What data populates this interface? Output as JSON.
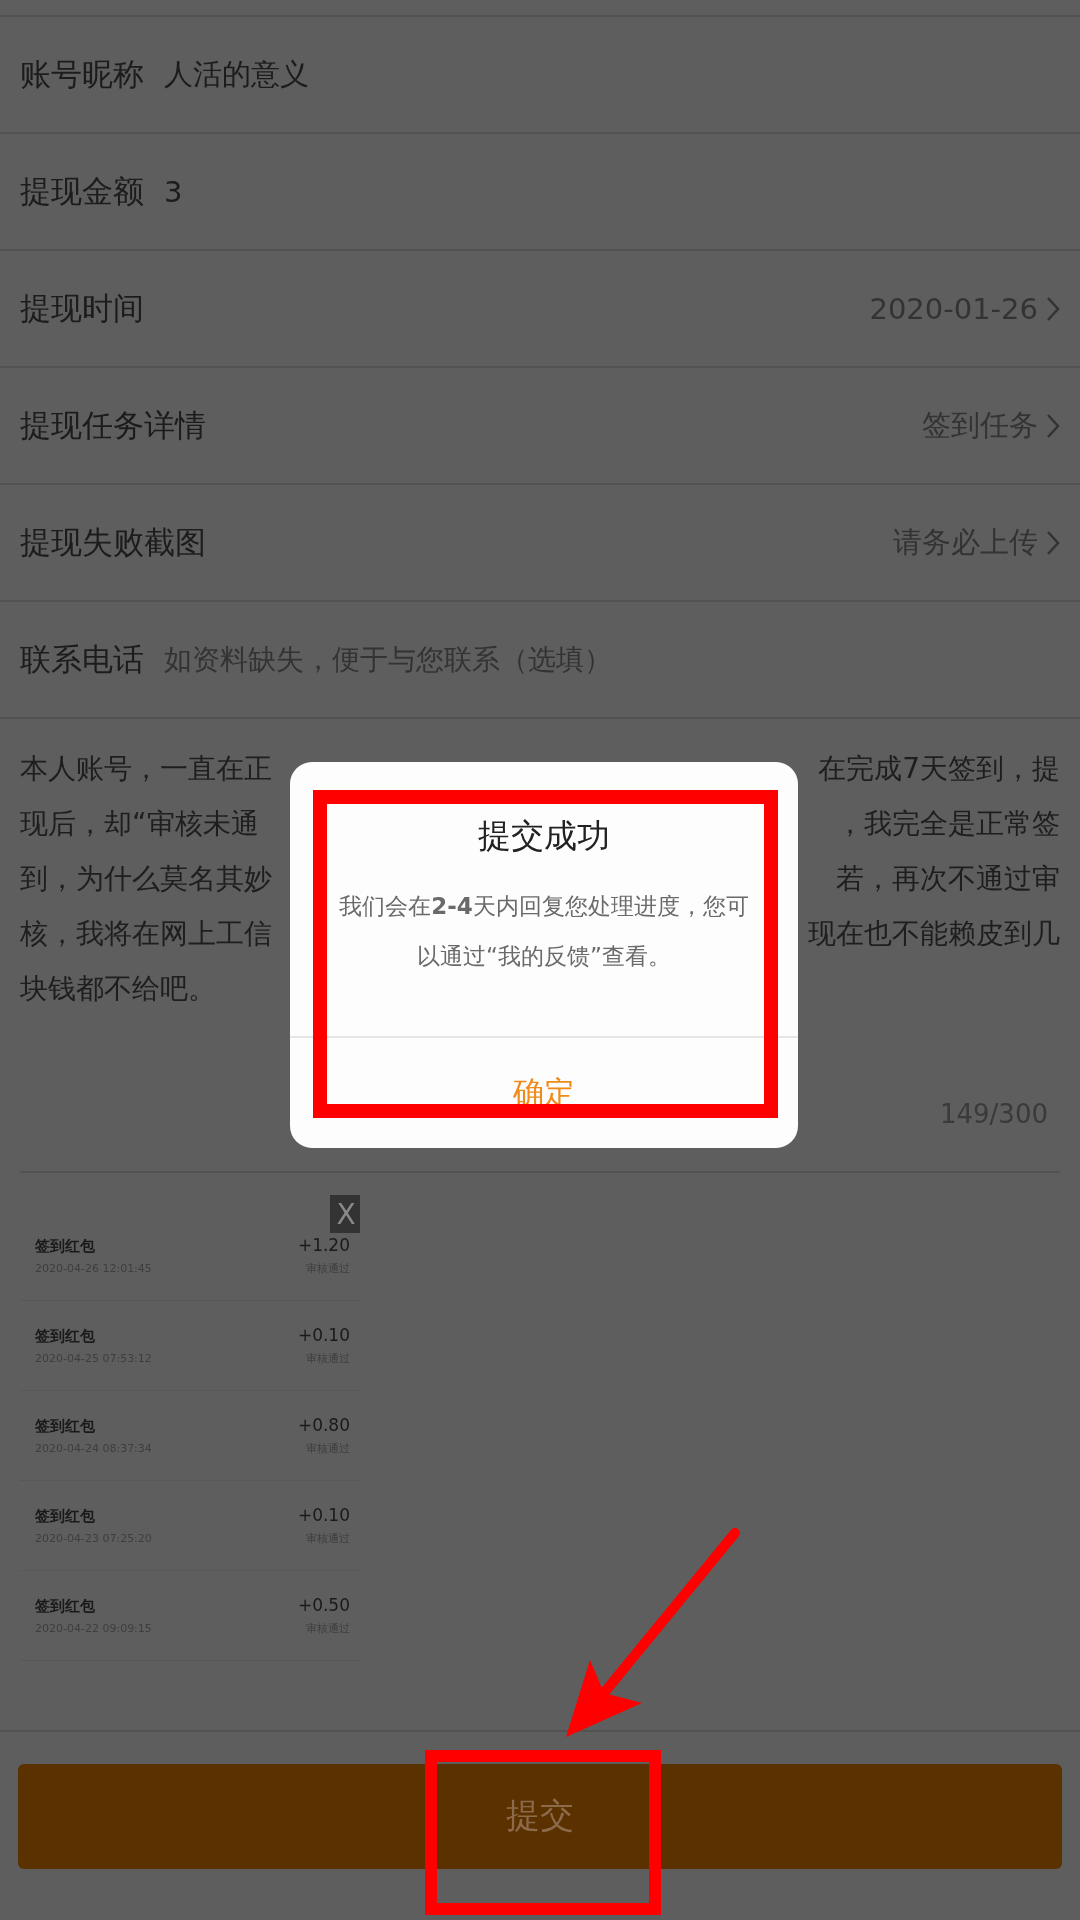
{
  "form_rows": [
    {
      "kind": "inline",
      "label": "账号昵称",
      "value": "人活的意义"
    },
    {
      "kind": "inline",
      "label": "提现金额",
      "value": "3"
    },
    {
      "kind": "link",
      "label": "提现时间",
      "value": "2020-01-26"
    },
    {
      "kind": "link",
      "label": "提现任务详情",
      "value": "签到任务"
    },
    {
      "kind": "link",
      "label": "提现失败截图",
      "value": "请务必上传"
    },
    {
      "kind": "input",
      "label": "联系电话",
      "placeholder": "如资料缺失，便于与您联系（选填）"
    }
  ],
  "description": {
    "lines": [
      {
        "left": "本人账号，一直在正",
        "right": "在完成7天签到，提"
      },
      {
        "left": "现后，却“审核未通",
        "right": "，我完全是正常签"
      },
      {
        "left": "到，为什么莫名其妙",
        "right": "若，再次不通过审"
      },
      {
        "left": "核，我将在网上工信",
        "right": "现在也不能赖皮到几"
      },
      {
        "left": "块钱都不给吧。"
      }
    ],
    "counter": "149/300"
  },
  "screenshot": {
    "close": "X",
    "items": [
      {
        "title": "签到红包",
        "time": "2020-04-26 12:01:45",
        "amount": "+1.20",
        "status": "审核通过"
      },
      {
        "title": "签到红包",
        "time": "2020-04-25 07:53:12",
        "amount": "+0.10",
        "status": "审核通过"
      },
      {
        "title": "签到红包",
        "time": "2020-04-24 08:37:34",
        "amount": "+0.80",
        "status": "审核通过"
      },
      {
        "title": "签到红包",
        "time": "2020-04-23 07:25:20",
        "amount": "+0.10",
        "status": "审核通过"
      },
      {
        "title": "签到红包",
        "time": "2020-04-22 09:09:15",
        "amount": "+0.50",
        "status": "审核通过"
      }
    ]
  },
  "submit_button": "提交",
  "dialog": {
    "title": "提交成功",
    "message": "我们会在**2-4**天内回复您处理进度，您可以通过“我的反馈”查看。",
    "confirm": "确定"
  }
}
